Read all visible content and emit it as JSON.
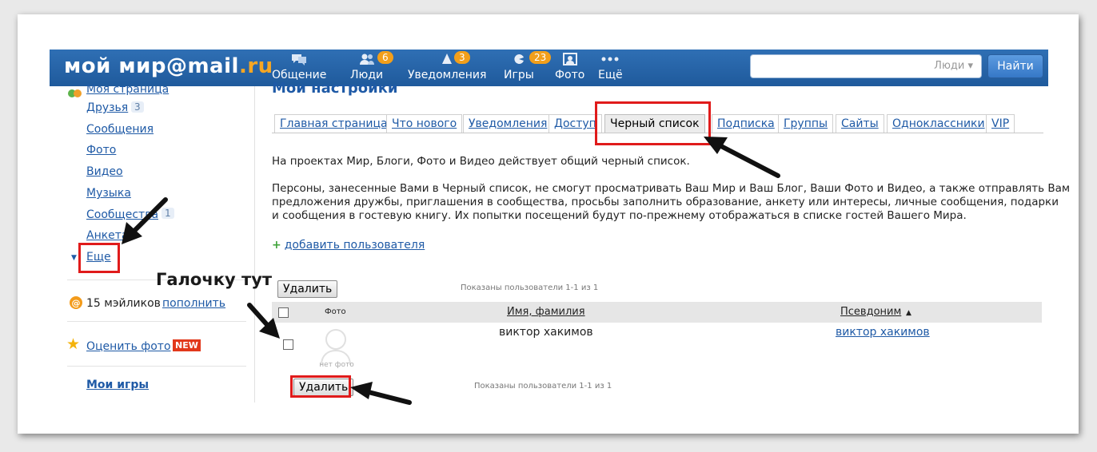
{
  "header": {
    "logo_text": "мой мир@mail",
    "logo_suffix": ".ru",
    "nav": [
      {
        "label": "Общение",
        "icon": "chat-icon",
        "badge": ""
      },
      {
        "label": "Люди",
        "icon": "people-icon",
        "badge": "6"
      },
      {
        "label": "Уведомления",
        "icon": "bell-icon",
        "badge": "3"
      },
      {
        "label": "Игры",
        "icon": "gamepad-icon",
        "badge": "23"
      },
      {
        "label": "Фото",
        "icon": "photo-icon",
        "badge": ""
      },
      {
        "label": "Ещё",
        "icon": "more-icon",
        "badge": ""
      }
    ],
    "search": {
      "placeholder": "",
      "scope": "Люди ▾"
    },
    "search_button": "Найти"
  },
  "sidebar": {
    "items": [
      {
        "label": "Моя страница",
        "count": ""
      },
      {
        "label": "Друзья",
        "count": "3"
      },
      {
        "label": "Сообщения",
        "count": ""
      },
      {
        "label": "Фото",
        "count": ""
      },
      {
        "label": "Видео",
        "count": ""
      },
      {
        "label": "Музыка",
        "count": ""
      },
      {
        "label": "Сообщества",
        "count": "1"
      },
      {
        "label": "Анкета",
        "count": ""
      },
      {
        "label": "Еще",
        "count": ""
      }
    ],
    "mailiki_text": "15 мэйликов",
    "mailiki_link": "пополнить",
    "rate_photo": "Оценить фото",
    "new_badge": "NEW",
    "my_games": "Мои игры"
  },
  "main": {
    "title": "Мои настройки",
    "tabs": [
      {
        "label": "Главная страница"
      },
      {
        "label": "Что нового"
      },
      {
        "label": "Уведомления"
      },
      {
        "label": "Доступ"
      },
      {
        "label": "Черный список",
        "active": true
      },
      {
        "label": "Подписка"
      },
      {
        "label": "Группы"
      },
      {
        "label": "Сайты"
      },
      {
        "label": "Одноклассники"
      },
      {
        "label": "VIP"
      }
    ],
    "para1": "На проектах Мир, Блоги, Фото и Видео действует общий черный список.",
    "para2_line1": "Персоны, занесенные Вами в Черный список, не смогут просматривать Ваш Мир и Ваш Блог, Ваши Фото и Видео, а также отправлять Вам",
    "para2_line2": "предложения дружбы, приглашения в сообщества, просьбы заполнить образование, анкету или интересы, личные сообщения, подарки",
    "para2_line3": "и сообщения в гостевую книгу. Их попытки посещений будут по-прежнему отображаться в списке гостей Вашего Мира.",
    "add_user": "добавить пользователя",
    "delete_button": "Удалить",
    "shown_text": "Показаны пользователи 1-1 из 1",
    "table": {
      "col_photo": "Фото",
      "col_name": "Имя, фамилия",
      "col_alias": "Псевдоним",
      "rows": [
        {
          "name": "виктор хакимов",
          "alias": "виктор хакимов",
          "photo_caption": "нет фото"
        }
      ]
    }
  },
  "annotation": {
    "callout": "Галочку тут",
    "highlight_color": "#e01b1b"
  }
}
